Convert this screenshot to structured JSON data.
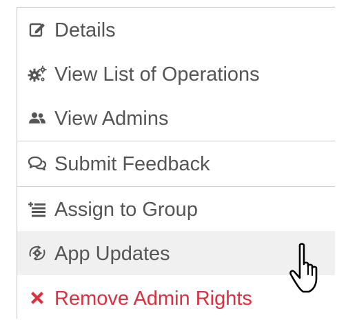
{
  "menu": {
    "items": [
      {
        "label": "Details",
        "icon": "edit-icon"
      },
      {
        "label": "View List of Operations",
        "icon": "gears-icon"
      },
      {
        "label": "View Admins",
        "icon": "users-icon"
      },
      {
        "label": "Submit Feedback",
        "icon": "comments-icon"
      },
      {
        "label": "Assign to Group",
        "icon": "add-to-list-icon"
      },
      {
        "label": "App Updates",
        "icon": "app-update-icon",
        "state": "hovered"
      },
      {
        "label": "Remove Admin Rights",
        "icon": "close-x-icon",
        "state": "danger"
      }
    ]
  },
  "colors": {
    "text": "#555555",
    "danger": "#d9313f",
    "hover_background": "#f0f0f0",
    "divider": "#cfcfcf",
    "border": "#c8c8c8"
  },
  "cursor": {
    "icon": "hand-pointer-icon"
  }
}
